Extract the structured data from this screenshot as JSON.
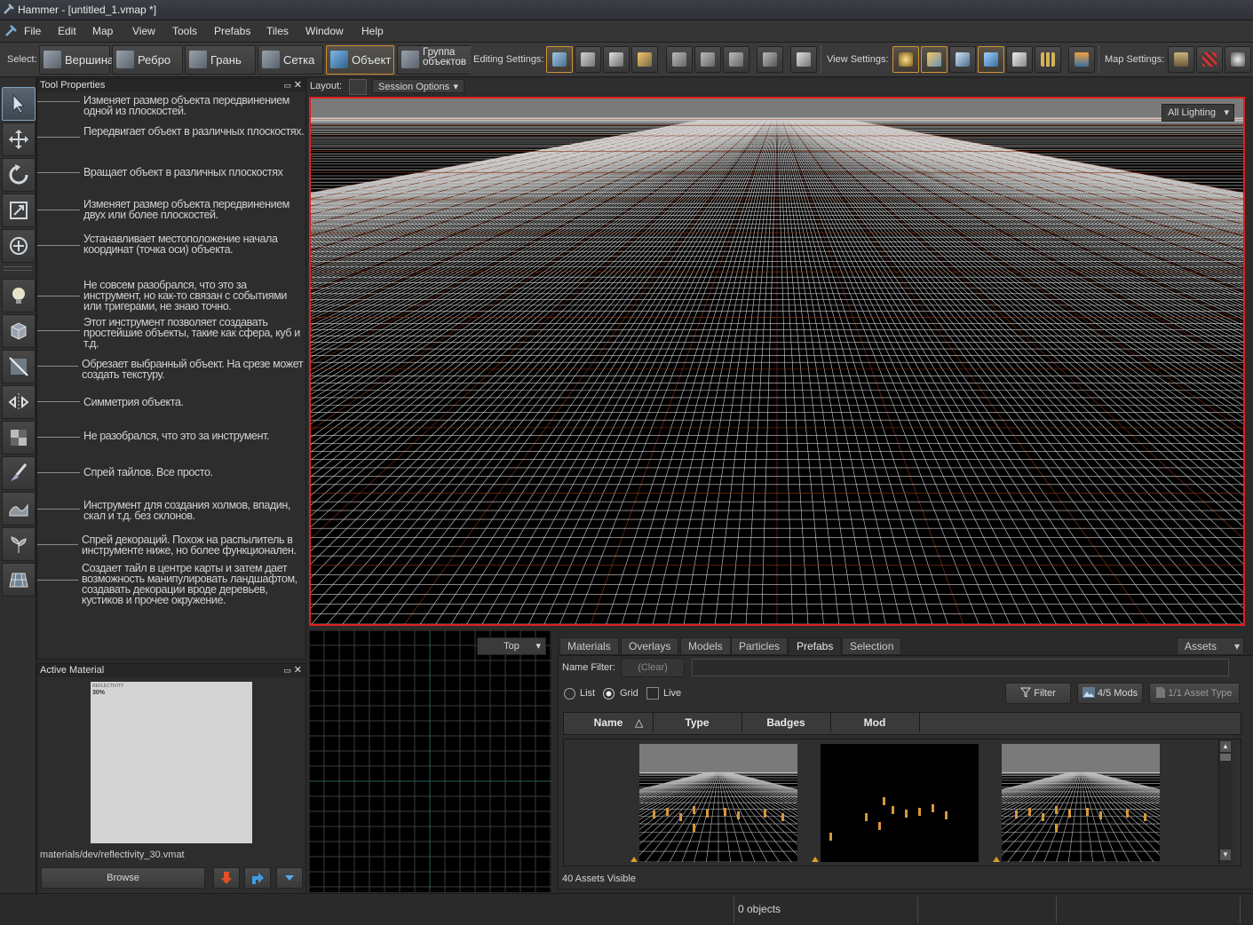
{
  "window": {
    "title": "Hammer - [untitled_1.vmap *]"
  },
  "menu": [
    "File",
    "Edit",
    "Map",
    "View",
    "Tools",
    "Prefabs",
    "Tiles",
    "Window",
    "Help"
  ],
  "toolbar": {
    "select_label": "Select:",
    "select_modes": [
      "Вершина",
      "Ребро",
      "Грань",
      "Сетка",
      "Объект",
      "Группа объектов"
    ],
    "editing_label": "Editing Settings:",
    "view_label": "View Settings:",
    "map_label": "Map Settings:"
  },
  "tool_properties": {
    "title": "Tool Properties",
    "descriptions": [
      "Изменяет размер объекта передвинением одной из плоскостей.",
      "Передвигает объект в различных плоскостях.",
      "Вращает объект в различных плоскостях",
      "Изменяет размер объекта передвинением двух или более плоскостей.",
      "Устанавливает местоположение начала координат (точка оси) объекта.",
      "Не совсем разобрался, что это за инструмент, но как-то связан с событиями или тригерами, не знаю точно.",
      "Этот инструмент позволяет создавать простейшие объекты, такие как сфера, куб и т.д.",
      "Обрезает выбранный объект. На срезе может создать текстуру.",
      "Симметрия объекта.",
      "Не разобрался, что это за инструмент.",
      "Спрей тайлов. Все просто.",
      "Инструмент для создания холмов, впадин, скал и т.д. без склонов.",
      "Спрей декораций. Похож на распылитель в инструменте ниже, но более функционален.",
      "Создает тайл в центре карты и затем дает возможность манипулировать ландшафтом, создавать декорации вроде деревьев, кустиков и прочее окружение."
    ]
  },
  "active_material": {
    "title": "Active Material",
    "swatch_line1": "REFLECTIVITY",
    "swatch_line2": "30%",
    "path": "materials/dev/reflectivity_30.vmat",
    "browse_label": "Browse"
  },
  "layout_bar": {
    "layout_label": "Layout:",
    "session_options": "Session Options"
  },
  "viewport": {
    "lighting": "All Lighting",
    "view2d": "Top"
  },
  "asset_browser": {
    "tabs": [
      "Materials",
      "Overlays",
      "Models",
      "Particles",
      "Prefabs",
      "Selection"
    ],
    "active_tab": "Prefabs",
    "assets_dropdown": "Assets",
    "name_filter_label": "Name Filter:",
    "clear_label": "(Clear)",
    "view_modes": [
      "List",
      "Grid",
      "Live"
    ],
    "filter_label": "Filter",
    "mods_label": "4/5 Mods",
    "asset_type_label": "1/1 Asset Type",
    "columns": [
      "Name",
      "Type",
      "Badges",
      "Mod"
    ],
    "assets_visible": "40 Assets Visible"
  },
  "status": {
    "objects": "0 objects"
  },
  "colors": {
    "accent": "#d4902e",
    "selection_border": "#e02020",
    "grid_orange": "#8a3a1a"
  }
}
